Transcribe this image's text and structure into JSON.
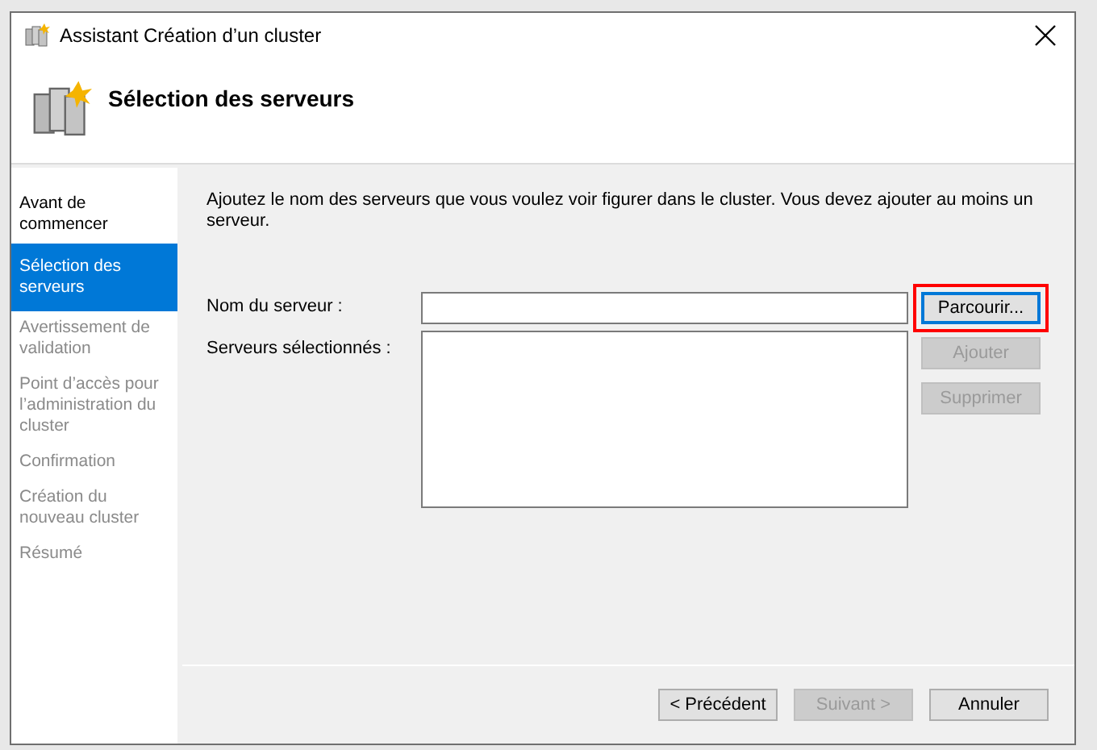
{
  "window": {
    "title": "Assistant Création d’un cluster"
  },
  "header": {
    "title": "Sélection des serveurs"
  },
  "steps": [
    {
      "label": "Avant de commencer",
      "selected": false,
      "disabled": false
    },
    {
      "label": "Sélection des serveurs",
      "selected": true,
      "disabled": false
    },
    {
      "label": "Avertissement de validation",
      "selected": false,
      "disabled": true
    },
    {
      "label": "Point d’accès pour l’administration du cluster",
      "selected": false,
      "disabled": true
    },
    {
      "label": "Confirmation",
      "selected": false,
      "disabled": true
    },
    {
      "label": "Création du nouveau cluster",
      "selected": false,
      "disabled": true
    },
    {
      "label": "Résumé",
      "selected": false,
      "disabled": true
    }
  ],
  "intro": "Ajoutez le nom des serveurs que vous voulez voir figurer dans le cluster. Vous devez ajouter au moins un serveur.",
  "server_name": {
    "label": "Nom du serveur :"
  },
  "selected_servers": {
    "label": "Serveurs sélectionnés :"
  },
  "side_buttons": [
    {
      "label": "Parcourir...",
      "disabled": false,
      "highlighted": true
    },
    {
      "label": "Ajouter",
      "disabled": true,
      "highlighted": false
    },
    {
      "label": "Supprimer",
      "disabled": true,
      "highlighted": false
    }
  ],
  "footer_buttons": [
    {
      "label": "< Précédent",
      "disabled": false
    },
    {
      "label": "Suivant >",
      "disabled": true
    },
    {
      "label": "Annuler",
      "disabled": false
    }
  ]
}
